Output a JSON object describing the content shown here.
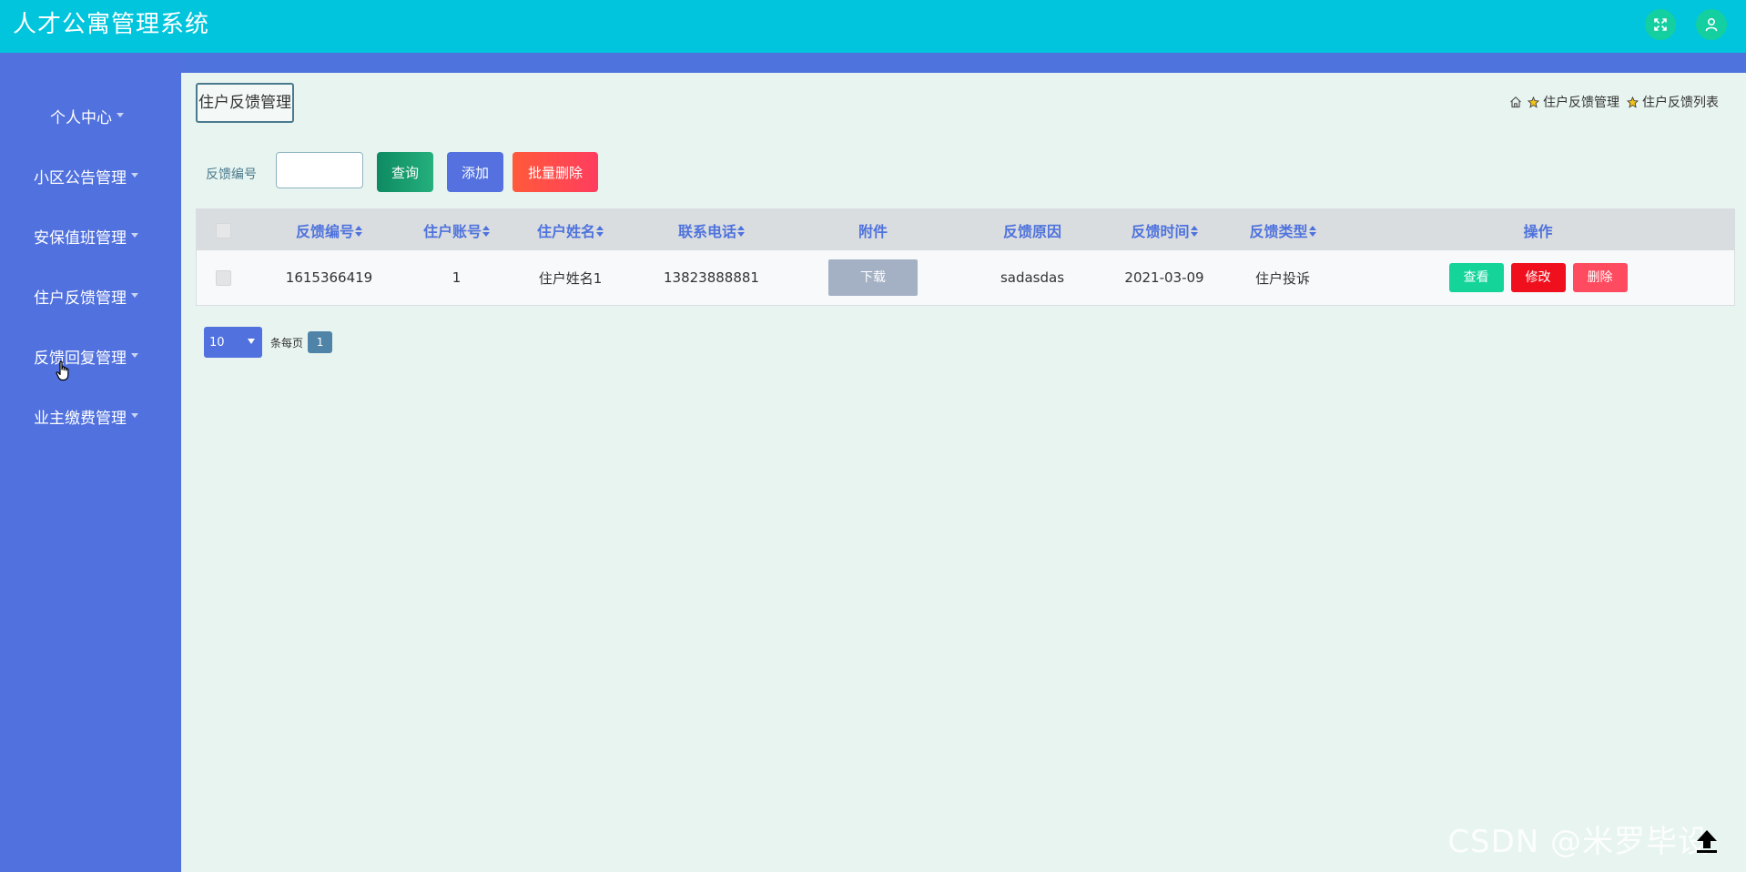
{
  "header": {
    "title": "人才公寓管理系统",
    "fullscreen_icon": "fullscreen-icon",
    "user_icon": "user-icon"
  },
  "sidebar": {
    "items": [
      {
        "label": "个人中心"
      },
      {
        "label": "小区公告管理"
      },
      {
        "label": "安保值班管理"
      },
      {
        "label": "住户反馈管理"
      },
      {
        "label": "反馈回复管理"
      },
      {
        "label": "业主缴费管理"
      }
    ]
  },
  "main": {
    "page_tag": "住户反馈管理",
    "breadcrumb": [
      "住户反馈管理",
      "住户反馈列表"
    ],
    "search": {
      "label": "反馈编号",
      "value": "",
      "query_label": "查询",
      "add_label": "添加",
      "batch_delete_label": "批量删除"
    },
    "table": {
      "headers": [
        "反馈编号",
        "住户账号",
        "住户姓名",
        "联系电话",
        "附件",
        "反馈原因",
        "反馈时间",
        "反馈类型",
        "操作"
      ],
      "rows": [
        {
          "id": "1615366419",
          "account": "1",
          "name": "住户姓名1",
          "phone": "13823888881",
          "attachment": "下载",
          "reason": "sadasdas",
          "time": "2021-03-09",
          "type": "住户投诉",
          "actions": [
            "查看",
            "修改",
            "删除"
          ]
        }
      ]
    },
    "pagination": {
      "page_size": "10",
      "per_page_label": "条每页",
      "current_page": "1"
    }
  },
  "watermark": "CSDN @米罗毕设",
  "colors": {
    "header": "#00c5dc",
    "sidebar": "#5171de",
    "background": "#e8f4ef",
    "accent": "#4f73dc"
  }
}
